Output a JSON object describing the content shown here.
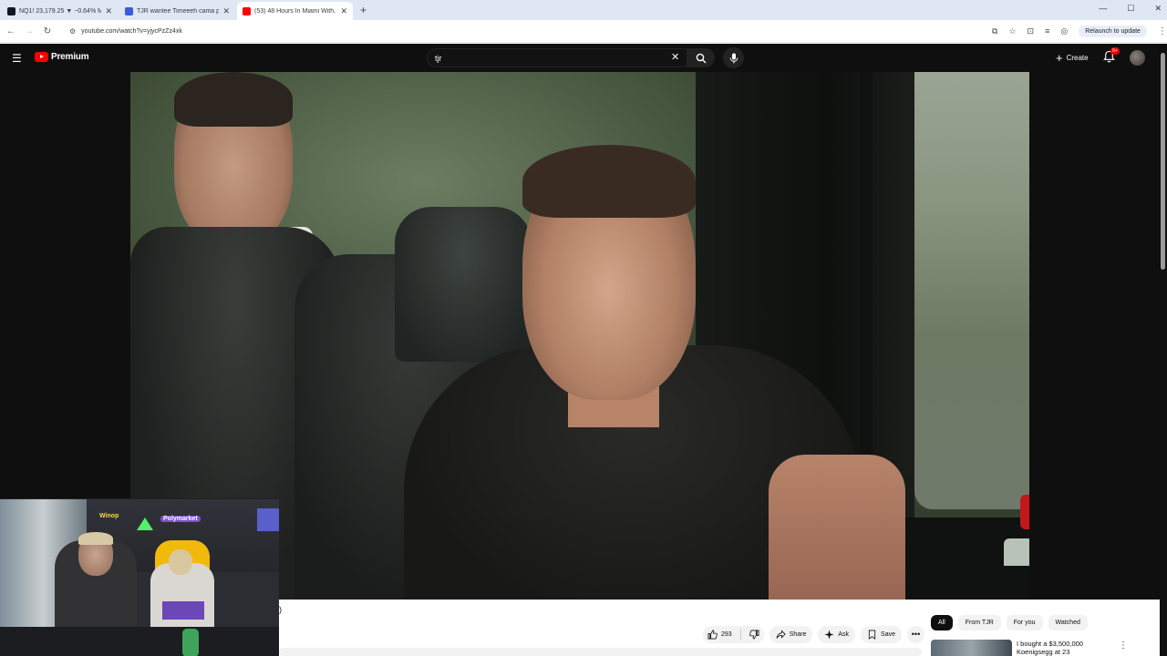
{
  "browser": {
    "tabs": [
      {
        "title": "NQ1! 23,179.25 ▼ −0.64% MA…",
        "favicon_color": "#131722"
      },
      {
        "title": "TJR wantee Timeeeh cama proj…",
        "favicon_color": "#3b5bdb"
      },
      {
        "title": "(53) 48 Hours In Miami With…",
        "favicon_color": "#ff0000"
      }
    ],
    "url": "youtube.com/watch?v=yjycPzZz4xk",
    "relaunch_label": "Relaunch to update"
  },
  "youtube": {
    "brand": "Premium",
    "search_value": "tjr",
    "create_label": "Create",
    "notification_count": "9+"
  },
  "video_below": {
    "title_fragment": ")",
    "like_count": "293",
    "share_label": "Share",
    "ask_label": "Ask",
    "save_label": "Save"
  },
  "sidebar": {
    "filters": [
      "All",
      "From TJR",
      "For you",
      "Watched"
    ],
    "active_filter": "All",
    "recommendation_title": "I bought a $3,500,000 Koenigsegg at 23"
  },
  "webcam": {
    "sign_left": "Winop",
    "sign_right": "Polymarket"
  },
  "colors": {
    "yt_dark": "#0f0f0f",
    "yt_red": "#ff0000",
    "chip_bg": "#f2f2f2"
  }
}
